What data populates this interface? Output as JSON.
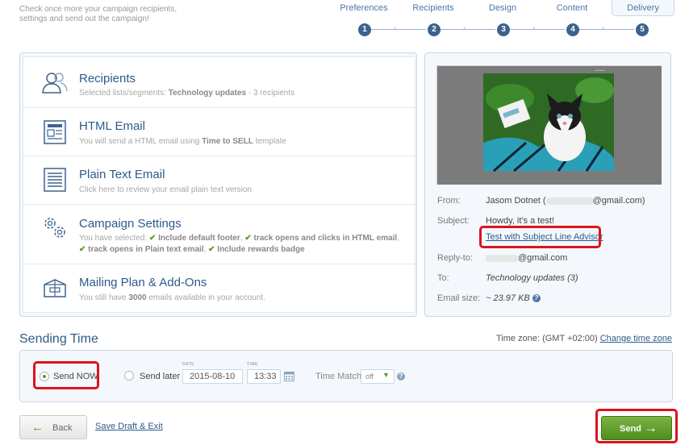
{
  "intro": "Check once more your campaign recipients, settings and send out the campaign!",
  "steps": [
    {
      "label": "Preferences",
      "num": "1"
    },
    {
      "label": "Recipients",
      "num": "2"
    },
    {
      "label": "Design",
      "num": "3"
    },
    {
      "label": "Content",
      "num": "4"
    },
    {
      "label": "Delivery",
      "num": "5"
    }
  ],
  "summary": {
    "recipients": {
      "title": "Recipients",
      "desc_prefix": "Selected lists/segments: ",
      "desc_bold": "Technology updates",
      "desc_suffix": " - 3 recipients"
    },
    "html_email": {
      "title": "HTML Email",
      "desc_prefix": "You will send a HTML email using ",
      "desc_bold": "Time to SELL",
      "desc_suffix": " template"
    },
    "plain_text": {
      "title": "Plain Text Email",
      "desc": "Click here to review your email plain text version"
    },
    "campaign_settings": {
      "title": "Campaign Settings",
      "desc_prefix": "You have selected: ",
      "opt1": "Include default footer",
      "opt2": "track opens and clicks in HTML email",
      "opt3": "track opens in Plain text email",
      "opt4": "Include rewards badge",
      "sep": ","
    },
    "mailing_plan": {
      "title": "Mailing Plan & Add-Ons",
      "desc_prefix": "You still have ",
      "desc_bold": "3000",
      "desc_suffix": " emails available in your account."
    }
  },
  "preview": {
    "from_label": "From:",
    "from_name": "Jasom Dotnet",
    "from_email_suffix": "@gmail.com)",
    "subject_label": "Subject:",
    "subject": "Howdy, it's a test!",
    "subject_advisor_link": "Test with Subject Line Advisor",
    "replyto_label": "Reply-to:",
    "replyto_suffix": "@gmail.com",
    "to_label": "To:",
    "to": "Technology updates (3)",
    "size_label": "Email size:",
    "size": "~ 23.97 KB",
    "help": "?"
  },
  "sending": {
    "title": "Sending Time",
    "timezone_label": "Time zone: (GMT +02:00)",
    "change_timezone": "Change time zone",
    "send_now": "Send NOW",
    "send_later": "Send later",
    "date_label": "DATE",
    "date": "2015-08-10",
    "time_label": "TIME",
    "time": "13:33",
    "time_match_label": "Time Match",
    "time_match_value": "off",
    "help": "?"
  },
  "actions": {
    "back": "Back",
    "save_draft": "Save Draft & Exit",
    "send": "Send"
  },
  "colors": {
    "accent_blue": "#2e5a8a",
    "step_blue": "#3c638e",
    "send_green": "#5c9a2a",
    "highlight_red": "#d9151b"
  }
}
